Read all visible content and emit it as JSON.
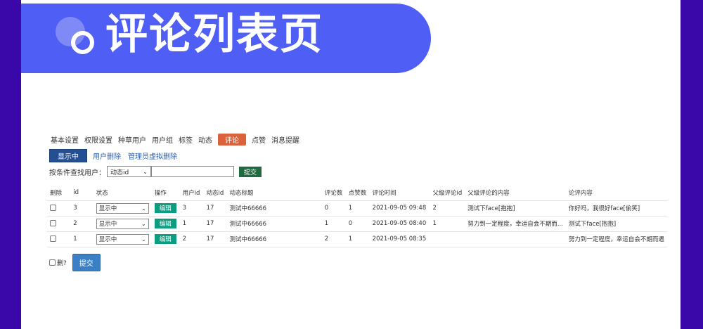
{
  "banner": {
    "title": "评论列表页"
  },
  "nav": {
    "items": [
      "基本设置",
      "权限设置",
      "种草用户",
      "用户组",
      "标签",
      "动态",
      "评论",
      "点赞",
      "消息提醒"
    ],
    "active_index": 6
  },
  "subnav": {
    "show_label": "显示中",
    "user_delete": "用户删除",
    "admin_delete": "管理员虚拟删除"
  },
  "search": {
    "label": "按条件查找用户：",
    "field_selected": "动态id",
    "value": "",
    "submit_label": "提交"
  },
  "table": {
    "headers": [
      "删除",
      "id",
      "状态",
      "操作",
      "用户id",
      "动态id",
      "动态标题",
      "评论数",
      "点赞数",
      "评论时间",
      "父级评论id",
      "父级评论的内容",
      "论评内容"
    ],
    "rows": [
      {
        "id": "3",
        "status": "显示中",
        "edit": "编辑",
        "user_id": "3",
        "dynamic_id": "17",
        "dynamic_title": "测试中66666",
        "comments": "0",
        "likes": "1",
        "time": "2021-09-05 09:48",
        "parent_id": "2",
        "parent_content": "测试下face[抱抱]",
        "content": "你好吗，我很好face[偷笑]"
      },
      {
        "id": "2",
        "status": "显示中",
        "edit": "编辑",
        "user_id": "1",
        "dynamic_id": "17",
        "dynamic_title": "测试中66666",
        "comments": "1",
        "likes": "0",
        "time": "2021-09-05 08:40",
        "parent_id": "1",
        "parent_content": "努力到一定程度，幸运自会不期而...",
        "content": "测试下face[抱抱]"
      },
      {
        "id": "1",
        "status": "显示中",
        "edit": "编辑",
        "user_id": "2",
        "dynamic_id": "17",
        "dynamic_title": "测试中66666",
        "comments": "2",
        "likes": "1",
        "time": "2021-09-05 08:35",
        "parent_id": "",
        "parent_content": "",
        "content": "努力到一定程度，幸运自会不期而遇"
      }
    ]
  },
  "footer": {
    "delete_label": "删?",
    "submit_label": "提交"
  },
  "icons": {
    "chevron": "chevron-down-icon"
  },
  "colors": {
    "page_bg": "#3a07a8",
    "banner": "#4f5ef4",
    "active_tab": "#d9623c",
    "edit_button": "#0b9d7f",
    "submit_button": "#3b7fc4"
  }
}
